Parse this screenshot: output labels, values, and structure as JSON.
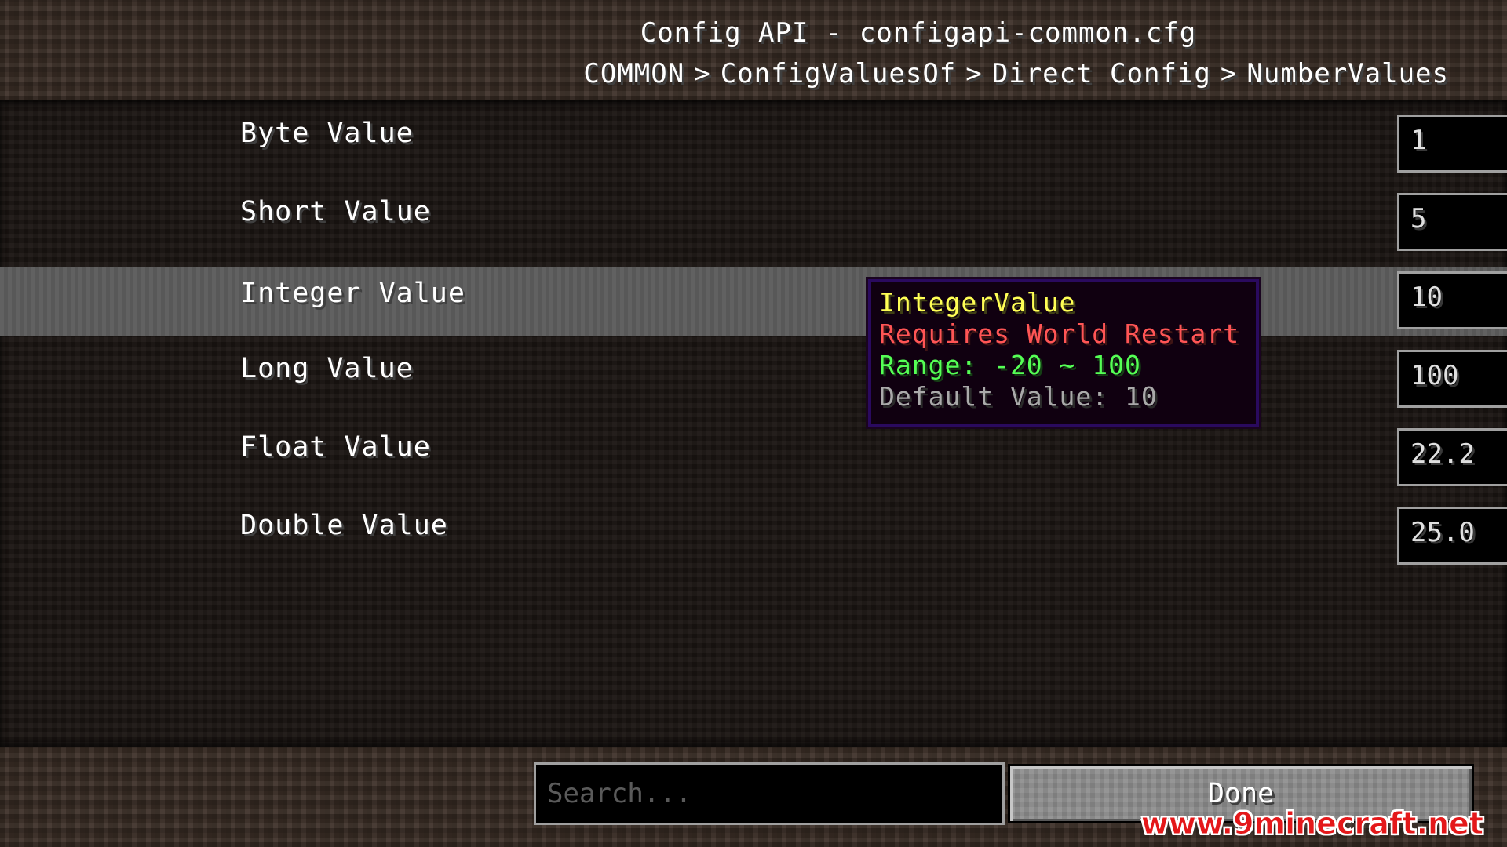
{
  "header": {
    "title": "Config API - configapi-common.cfg",
    "breadcrumb": [
      "COMMON",
      "ConfigValuesOf",
      "Direct Config",
      "NumberValues"
    ],
    "separator": ">"
  },
  "entries": [
    {
      "label": "Byte Value",
      "value": "1"
    },
    {
      "label": "Short Value",
      "value": "5"
    },
    {
      "label": "Integer Value",
      "value": "10"
    },
    {
      "label": "Long Value",
      "value": "100"
    },
    {
      "label": "Float Value",
      "value": "22.2"
    },
    {
      "label": "Double Value",
      "value": "25.0"
    }
  ],
  "hovered_entry": "Integer Value",
  "tooltip": {
    "title": "IntegerValue",
    "restart": "Requires World Restart",
    "range": "Range: -20 ~ 100",
    "default": "Default Value: 10"
  },
  "footer": {
    "search_placeholder": "Search...",
    "done_label": "Done"
  },
  "watermark": "www.9minecraft.net",
  "colors": {
    "tooltip_title": "#ffff55",
    "tooltip_restart": "#ff5555",
    "tooltip_range": "#55ff55",
    "tooltip_default": "#aaaaaa",
    "tooltip_border": "#2a0a5e",
    "hover_row": "#5c5c5c"
  }
}
